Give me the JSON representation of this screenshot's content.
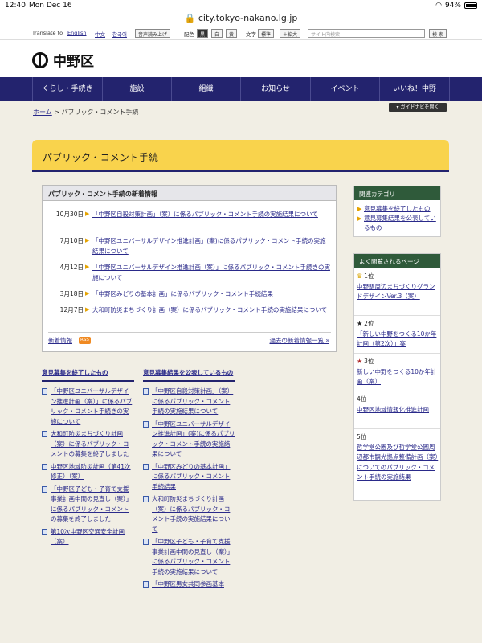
{
  "status_bar": {
    "time": "12:40",
    "date": "Mon Dec 16",
    "battery": "94%"
  },
  "browser": {
    "url": "city.tokyo-nakano.lg.jp"
  },
  "toolbar": {
    "translate_label": "Translate to",
    "english": "English",
    "chinese": "中文",
    "korean": "한국어",
    "voice": "音声読み上げ",
    "color_label": "配色",
    "color_black": "黒",
    "color_white": "白",
    "color_yellow": "黄",
    "font_label": "文字",
    "font_standard": "標準",
    "font_bigger": "＋拡大",
    "search_placeholder": "サイト内検索",
    "search_button": "検 索"
  },
  "header": {
    "logo_text": "中野区"
  },
  "nav": {
    "items": [
      "くらし・手続き",
      "施設",
      "組織",
      "お知らせ",
      "イベント",
      "いいね！中野"
    ]
  },
  "guide_button": "ガイドナビを開く",
  "breadcrumb": {
    "home": "ホーム",
    "sep": ">",
    "current": "パブリック・コメント手続"
  },
  "page_title": "パブリック・コメント手続",
  "news": {
    "heading": "パブリック・コメント手続の新着情報",
    "items": [
      {
        "date": "10月30日",
        "title": "「中野区自殺対策計画」（案）に係るパブリック・コメント手続の実施結果について"
      },
      {
        "date": "7月10日",
        "title": "「中野区ユニバーサルデザイン推進計画」(案)に係るパブリック・コメント手続の実施結果について"
      },
      {
        "date": "4月12日",
        "title": "「中野区ユニバーサルデザイン推進計画（案）」に係るパブリック・コメント手続きの実施について"
      },
      {
        "date": "3月18日",
        "title": "「中野区みどりの基本計画」に係るパブリック・コメント手続結果"
      },
      {
        "date": "12月7日",
        "title": "大和町防災まちづくり計画（案）に係るパブリック・コメント手続の実施結果について"
      }
    ],
    "rss_label": "新着情報",
    "rss_badge": "RSS",
    "past_link": "過去の新着情報一覧 »"
  },
  "ended_column": {
    "heading": "意見募集を終了したもの",
    "items": [
      "「中野区ユニバーサルデザイン推進計画（案）」に係るパブリック・コメント手続きの実施について",
      "大和町防災まちづくり計画（案）に係るパブリック・コメントの募集を終了しました",
      "中野区地域防災計画（第41次修正）（案）",
      "「中野区子ども・子育て支援事業計画中間の見直し（案）」に係るパブリック・コメントの募集を終了しました",
      "第10次中野区交通安全計画（案）"
    ]
  },
  "results_column": {
    "heading": "意見募集結果を公表しているもの",
    "items": [
      "「中野区自殺対策計画」（案）に係るパブリック・コメント手続の実施結果について",
      "「中野区ユニバーサルデザイン推進計画」(案)に係るパブリック・コメント手続の実施結果について",
      "「中野区みどりの基本計画」に係るパブリック・コメント手続結果",
      "大和町防災まちづくり計画（案）に係るパブリック・コメント手続の実施結果について",
      "「中野区子ども・子育て支援事業計画中間の見直し（案）」に係るパブリック・コメント手続の実施結果について",
      "「中野区男女共同参画基本"
    ]
  },
  "related": {
    "heading": "関連カテゴリ",
    "items": [
      "意見募集を終了したもの",
      "意見募集結果を公表しているもの"
    ]
  },
  "ranking": {
    "heading": "よく閲覧されるページ",
    "items": [
      {
        "rank": "1位",
        "title": "中野駅周辺まちづくりグランドデザインVer.3（案）"
      },
      {
        "rank": "2位",
        "title": "「新しい中野をつくる10か年計画（第2次）」案"
      },
      {
        "rank": "3位",
        "title": "新しい中野をつくる10か年計画（案）"
      },
      {
        "rank": "4位",
        "title": "中野区地域情報化推進計画"
      },
      {
        "rank": "5位",
        "title": "哲学堂公園及び哲学堂公園周辺都市観光拠点整備計画（案）についてのパブリック・コメント手続の実施結果"
      }
    ]
  }
}
